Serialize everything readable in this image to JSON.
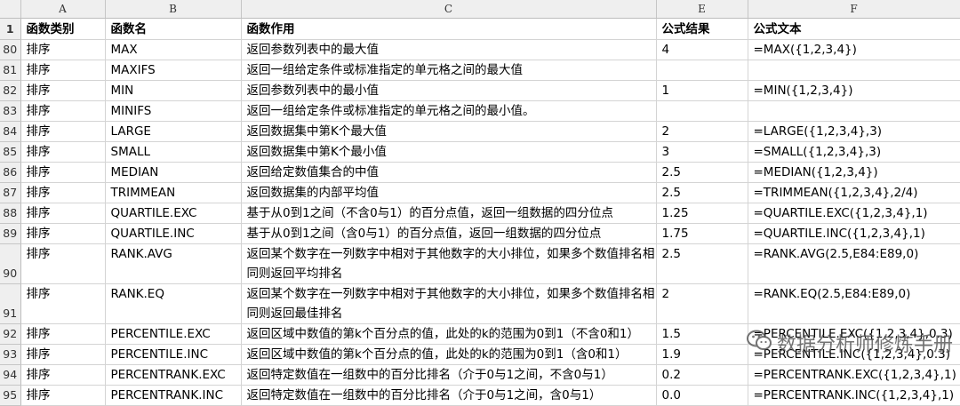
{
  "columns": [
    "A",
    "B",
    "C",
    "E",
    "F"
  ],
  "header": {
    "row_num": "1",
    "category": "函数类别",
    "name": "函数名",
    "purpose": "函数作用",
    "result": "公式结果",
    "formula": "公式文本"
  },
  "rows": [
    {
      "num": "80",
      "category": "排序",
      "name": "MAX",
      "purpose": "返回参数列表中的最大值",
      "result": "4",
      "formula": "=MAX({1,2,3,4})"
    },
    {
      "num": "81",
      "category": "排序",
      "name": "MAXIFS",
      "purpose": "返回一组给定条件或标准指定的单元格之间的最大值",
      "result": "",
      "formula": ""
    },
    {
      "num": "82",
      "category": "排序",
      "name": "MIN",
      "purpose": "返回参数列表中的最小值",
      "result": "1",
      "formula": "=MIN({1,2,3,4})"
    },
    {
      "num": "83",
      "category": "排序",
      "name": "MINIFS",
      "purpose": "返回一组给定条件或标准指定的单元格之间的最小值。",
      "result": "",
      "formula": ""
    },
    {
      "num": "84",
      "category": "排序",
      "name": "LARGE",
      "purpose": "返回数据集中第K个最大值",
      "result": "2",
      "formula": "=LARGE({1,2,3,4},3)"
    },
    {
      "num": "85",
      "category": "排序",
      "name": "SMALL",
      "purpose": "返回数据集中第K个最小值",
      "result": "3",
      "formula": "=SMALL({1,2,3,4},3)"
    },
    {
      "num": "86",
      "category": "排序",
      "name": "MEDIAN",
      "purpose": "返回给定数值集合的中值",
      "result": "2.5",
      "formula": "=MEDIAN({1,2,3,4})"
    },
    {
      "num": "87",
      "category": "排序",
      "name": "TRIMMEAN",
      "purpose": "返回数据集的内部平均值",
      "result": "2.5",
      "formula": "=TRIMMEAN({1,2,3,4},2/4)"
    },
    {
      "num": "88",
      "category": "排序",
      "name": "QUARTILE.EXC",
      "purpose": "基于从0到1之间（不含0与1）的百分点值，返回一组数据的四分位点",
      "result": "1.25",
      "formula": "=QUARTILE.EXC({1,2,3,4},1)"
    },
    {
      "num": "89",
      "category": "排序",
      "name": "QUARTILE.INC",
      "purpose": "基于从0到1之间（含0与1）的百分点值，返回一组数据的四分位点",
      "result": "1.75",
      "formula": "=QUARTILE.INC({1,2,3,4},1)"
    },
    {
      "num": "90",
      "category": "排序",
      "name": "RANK.AVG",
      "purpose": "返回某个数字在一列数字中相对于其他数字的大小排位，如果多个数值排名相同则返回平均排名",
      "result": "2.5",
      "formula": "=RANK.AVG(2.5,E84:E89,0)"
    },
    {
      "num": "91",
      "category": "排序",
      "name": "RANK.EQ",
      "purpose": "返回某个数字在一列数字中相对于其他数字的大小排位，如果多个数值排名相同则返回最佳排名",
      "result": "2",
      "formula": "=RANK.EQ(2.5,E84:E89,0)"
    },
    {
      "num": "92",
      "category": "排序",
      "name": "PERCENTILE.EXC",
      "purpose": "返回区域中数值的第k个百分点的值，此处的k的范围为0到1（不含0和1）",
      "result": "1.5",
      "formula": "=PERCENTILE.EXC({1,2,3,4},0.3)"
    },
    {
      "num": "93",
      "category": "排序",
      "name": "PERCENTILE.INC",
      "purpose": "返回区域中数值的第k个百分点的值，此处的k的范围为0到1（含0和1）",
      "result": "1.9",
      "formula": "=PERCENTILE.INC({1,2,3,4},0.3)"
    },
    {
      "num": "94",
      "category": "排序",
      "name": "PERCENTRANK.EXC",
      "purpose": "返回特定数值在一组数中的百分比排名（介于0与1之间，不含0与1）",
      "result": "0.2",
      "formula": "=PERCENTRANK.EXC({1,2,3,4},1)"
    },
    {
      "num": "95",
      "category": "排序",
      "name": "PERCENTRANK.INC",
      "purpose": "返回特定数值在一组数中的百分比排名（介于0与1之间，含0与1）",
      "result": "0.0",
      "formula": "=PERCENTRANK.INC({1,2,3,4},1)"
    }
  ],
  "watermark": {
    "text": "数据分析师修炼手册",
    "icon": "wechat-icon"
  }
}
